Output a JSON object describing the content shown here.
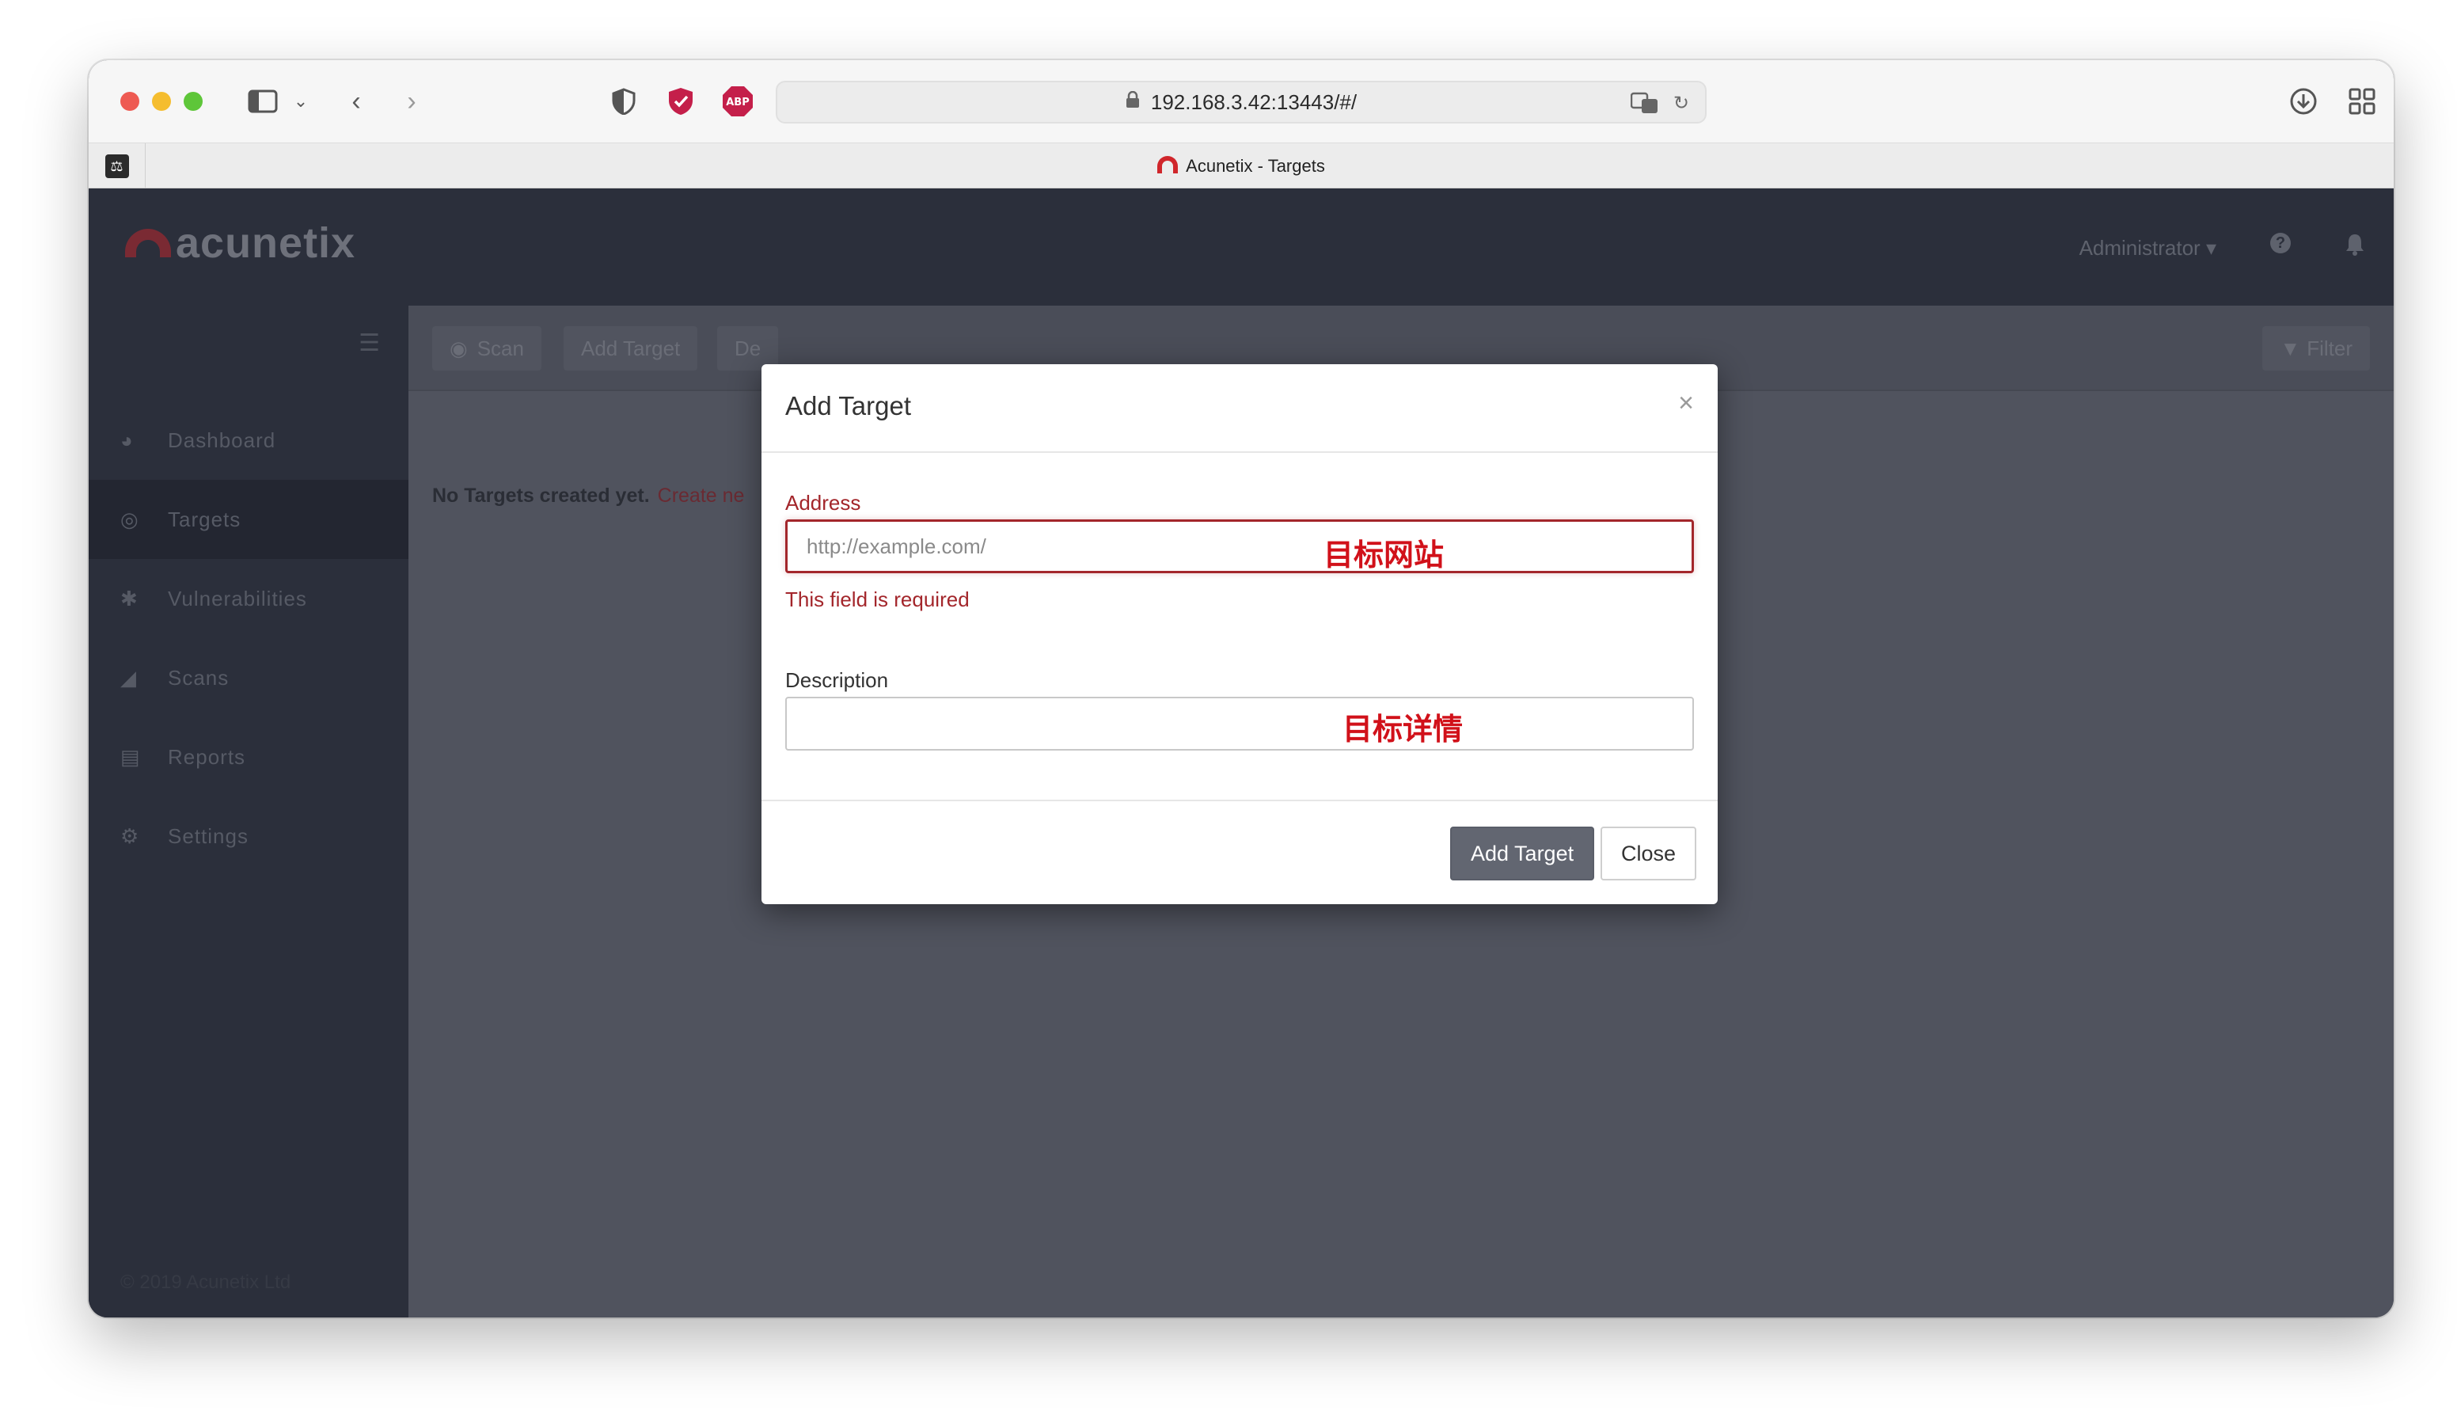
{
  "browser": {
    "url": "192.168.3.42:13443/#/",
    "tab_title": "Acunetix - Targets",
    "abp_label": "ABP"
  },
  "app": {
    "logo_text": "acunetix",
    "user_menu": "Administrator ▾",
    "help": "?",
    "sidebar": {
      "items": [
        {
          "label": "Dashboard",
          "icon": "dashboard-icon"
        },
        {
          "label": "Targets",
          "icon": "target-icon"
        },
        {
          "label": "Vulnerabilities",
          "icon": "bug-icon"
        },
        {
          "label": "Scans",
          "icon": "chart-icon"
        },
        {
          "label": "Reports",
          "icon": "report-icon"
        },
        {
          "label": "Settings",
          "icon": "gear-icon"
        }
      ],
      "copyright": "© 2019 Acunetix Ltd"
    },
    "actions": {
      "scan": "Scan",
      "add_target": "Add Target",
      "delete": "De",
      "filter": "Filter"
    },
    "content": {
      "empty_message": "No Targets created yet.",
      "create_link": "Create ne"
    }
  },
  "modal": {
    "title": "Add Target",
    "close_symbol": "×",
    "address": {
      "label": "Address",
      "placeholder": "http://example.com/",
      "value": "",
      "annotation": "目标网站",
      "error": "This field is required"
    },
    "description": {
      "label": "Description",
      "value": "",
      "annotation": "目标详情"
    },
    "buttons": {
      "submit": "Add Target",
      "close": "Close"
    }
  },
  "colors": {
    "accent_red": "#a3262b",
    "annotation_red": "#d1111a",
    "primary_button": "#626671"
  }
}
